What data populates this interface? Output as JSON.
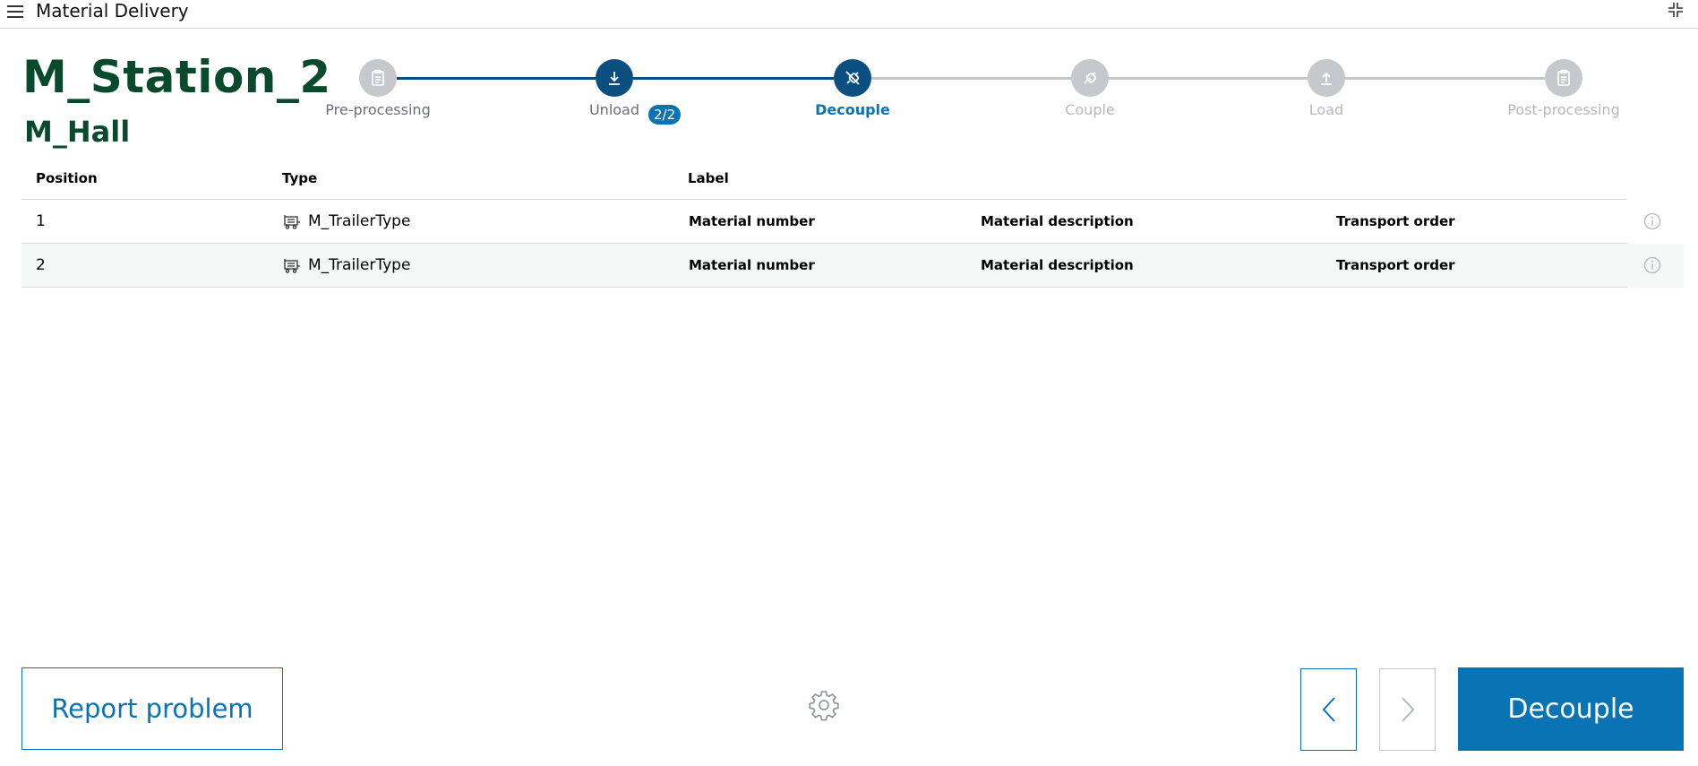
{
  "app": {
    "title": "Material Delivery"
  },
  "station": {
    "name": "M_Station_2",
    "hall": "M_Hall"
  },
  "stepper": {
    "active_color": "#0a4f7f",
    "inactive_color": "#c5c9cd",
    "steps": [
      {
        "label": "Pre-processing",
        "icon": "clipboard-icon",
        "state": "inactive-done"
      },
      {
        "label": "Unload",
        "icon": "download-icon",
        "state": "done",
        "badge": "2/2"
      },
      {
        "label": "Decouple",
        "icon": "unplug-icon",
        "state": "current"
      },
      {
        "label": "Couple",
        "icon": "plug-icon",
        "state": "pending"
      },
      {
        "label": "Load",
        "icon": "upload-icon",
        "state": "pending"
      },
      {
        "label": "Post-processing",
        "icon": "clipboard-icon",
        "state": "pending"
      }
    ]
  },
  "table": {
    "headers": {
      "position": "Position",
      "type": "Type",
      "label": "Label"
    },
    "rows": [
      {
        "position": "1",
        "type": "M_TrailerType",
        "material_number": "Material number",
        "material_description": "Material description",
        "transport_order": "Transport order"
      },
      {
        "position": "2",
        "type": "M_TrailerType",
        "material_number": "Material number",
        "material_description": "Material description",
        "transport_order": "Transport order"
      }
    ]
  },
  "actions": {
    "report": "Report problem",
    "primary": "Decouple"
  },
  "colors": {
    "brand_green": "#0a4a2c",
    "accent_blue": "#0a73b3"
  }
}
